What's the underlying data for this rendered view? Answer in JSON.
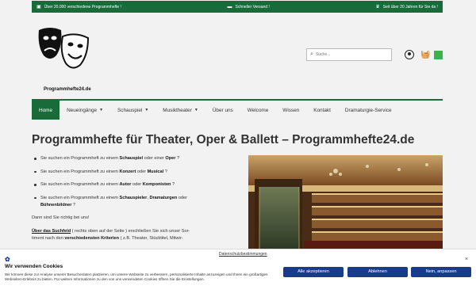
{
  "topbar": {
    "items": [
      {
        "icon": "truck-icon",
        "text": "Über 20.000 verschiedene Programmhefte !"
      },
      {
        "icon": "delivery-icon",
        "text": "Schneller Versand !"
      },
      {
        "icon": "trophy-icon",
        "text": "Seit über 20 Jahren für Sie da !"
      }
    ]
  },
  "header": {
    "logo_text": "Programmhefte24.de",
    "search_placeholder": "Suche...",
    "cart_count": ""
  },
  "nav": {
    "items": [
      {
        "label": "Home",
        "active": true
      },
      {
        "label": "Neueingänge",
        "dropdown": true
      },
      {
        "label": "Schauspiel",
        "dropdown": true
      },
      {
        "label": "Musiktheater",
        "dropdown": true
      },
      {
        "label": "Über uns"
      },
      {
        "label": "Welcome"
      },
      {
        "label": "Wissen"
      },
      {
        "label": "Kontakt"
      },
      {
        "label": "Dramaturgie-Service"
      }
    ]
  },
  "main": {
    "title": "Programmhefte für Theater, Oper & Ballett – Programmhefte24.de",
    "bullets": [
      {
        "pre": "Sie suchen ein Programmheft zu einem ",
        "b1": "Schauspiel",
        "mid": " oder einer ",
        "b2": "Oper",
        "post": " ?"
      },
      {
        "pre": "Sie suchen ein Programmheft zu einem ",
        "b1": "Konzert",
        "mid": " oder ",
        "b2": "Musical",
        "post": " ?"
      },
      {
        "pre": "Sie suchen ein Programmheft zu einem ",
        "b1": "Autor",
        "mid": " oder ",
        "b2": "Komponisten",
        "post": " ?"
      },
      {
        "pre": "Sie suchen ein Programmheft zu einem ",
        "b1": "Schauspieler",
        "mid": ", ",
        "b2": "Dramaturgen",
        "post": " oder",
        "b3": "Bühnenbildner",
        "post2": " ?"
      }
    ],
    "closing": "Dann sind Sie richtig bei uns!",
    "search_link": "Über das Suchfeld",
    "search_text1": " ( rechts oben auf der Seite ) erschließen Sie sich unser Sor-",
    "search_text2": "timent nach den ",
    "search_bold": "verschiedensten Kriterien",
    "search_text3": " ( z.B. Theater, Stücktitel, Mitwir-"
  },
  "cookie": {
    "policy_link": "Datenschutzbestimmungen",
    "title": "Wir verwenden Cookies",
    "text": "Wir können diese zur Analyse unserer Besucherdaten platzieren, um unsere Webseite zu verbessern, personalisierte Inhalte anzuzeigen und Ihnen ein großartiges Webseiten-Erlebnis zu bieten. Für weitere Informationen zu den von uns verwendeten Cookies öffnen Sie die Einstellungen.",
    "accept": "Alle akzeptieren",
    "reject": "Ablehnen",
    "adjust": "Nein, anpassen"
  }
}
